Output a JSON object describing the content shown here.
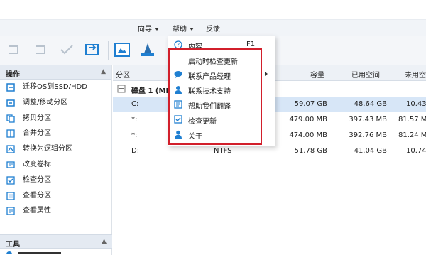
{
  "menubar": {
    "items": [
      {
        "label": "向导",
        "has_caret": true
      },
      {
        "label": "帮助",
        "has_caret": true
      },
      {
        "label": "反馈",
        "has_caret": false
      }
    ]
  },
  "sidebar": {
    "section_title": "操作",
    "items": [
      {
        "label": "迁移OS到SSD/HDD",
        "icon": "migrate-os-icon"
      },
      {
        "label": "调整/移动分区",
        "icon": "resize-partition-icon"
      },
      {
        "label": "拷贝分区",
        "icon": "copy-partition-icon"
      },
      {
        "label": "合并分区",
        "icon": "merge-partition-icon"
      },
      {
        "label": "转换为逻辑分区",
        "icon": "convert-logical-icon"
      },
      {
        "label": "改变卷标",
        "icon": "change-label-icon"
      },
      {
        "label": "检查分区",
        "icon": "check-partition-icon"
      },
      {
        "label": "查看分区",
        "icon": "view-partition-icon"
      },
      {
        "label": "查看属性",
        "icon": "properties-icon"
      }
    ],
    "tools_title": "工具"
  },
  "table": {
    "columns": {
      "partition": "分区",
      "capacity": "容量",
      "used": "已用空间",
      "unused": "未用空"
    },
    "disk_label": "磁盘 1 (MB",
    "rows": [
      {
        "partition": "C:",
        "filesystem": "",
        "capacity": "59.07 GB",
        "used": "48.64 GB",
        "unused": "10.43",
        "selected": true
      },
      {
        "partition": "*:",
        "filesystem": "",
        "capacity": "479.00 MB",
        "used": "397.43 MB",
        "unused": "81.57 M",
        "selected": false
      },
      {
        "partition": "*:",
        "filesystem": "",
        "capacity": "474.00 MB",
        "used": "392.76 MB",
        "unused": "81.24 M",
        "selected": false
      },
      {
        "partition": "D:",
        "filesystem": "NTFS",
        "capacity": "51.78 GB",
        "used": "41.04 GB",
        "unused": "10.74",
        "selected": false
      }
    ]
  },
  "help_menu": {
    "items": [
      {
        "label": "内容",
        "shortcut": "F1",
        "icon": "help-contents-icon",
        "submenu": false
      },
      {
        "label": "启动时检查更新",
        "shortcut": "",
        "icon": "",
        "submenu": false
      },
      {
        "label": "联系产品经理",
        "shortcut": "",
        "icon": "chat-bubble-icon",
        "submenu": true
      },
      {
        "label": "联系技术支持",
        "shortcut": "",
        "icon": "support-agent-icon",
        "submenu": false
      },
      {
        "label": "帮助我们翻译",
        "shortcut": "",
        "icon": "translate-icon",
        "submenu": false
      },
      {
        "label": "检查更新",
        "shortcut": "",
        "icon": "checkbox-icon",
        "submenu": false
      },
      {
        "label": "关于",
        "shortcut": "",
        "icon": "about-person-icon",
        "submenu": false
      }
    ],
    "highlight_color": "#d21f2b"
  },
  "colors": {
    "accent": "#1f7fd1",
    "selected_row": "#d7e6f7",
    "header_bg": "#e4eaf2"
  }
}
